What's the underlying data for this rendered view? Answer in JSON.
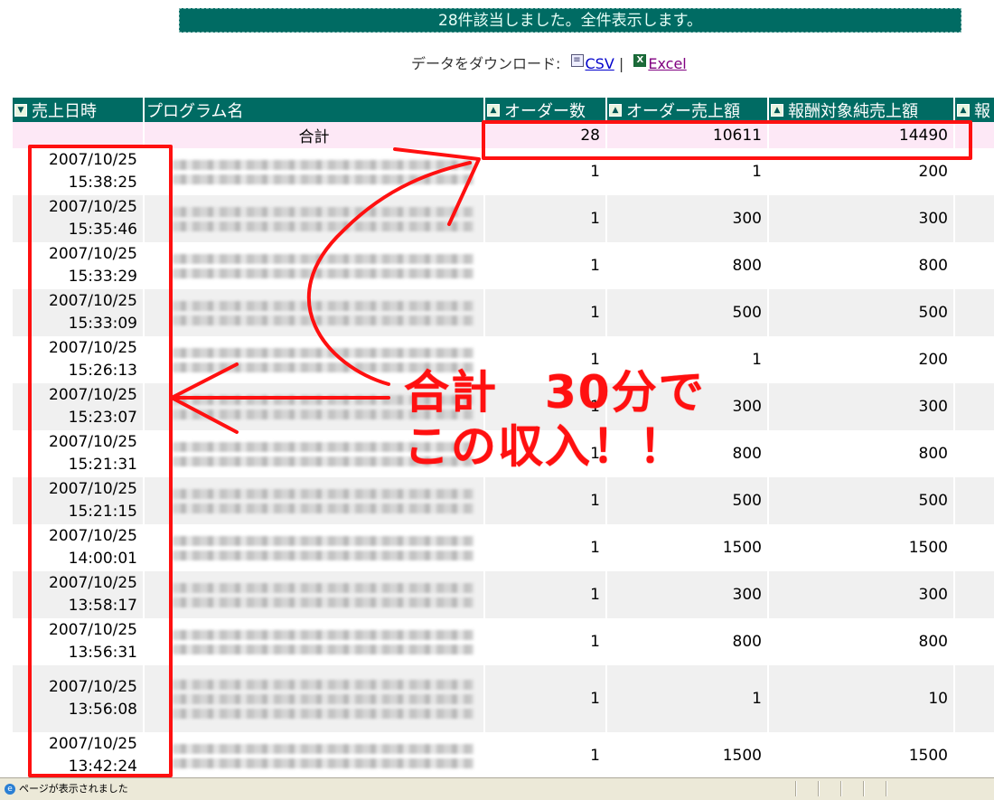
{
  "banner_text": "28件該当しました。全件表示します。",
  "download": {
    "label": "データをダウンロード:",
    "csv": "CSV",
    "separator": "|",
    "excel": "Excel"
  },
  "columns": [
    {
      "label": "売上日時",
      "sort_icon": true
    },
    {
      "label": "プログラム名",
      "sort_icon": false
    },
    {
      "label": "オーダー数",
      "sort_icon": true
    },
    {
      "label": "オーダー売上額",
      "sort_icon": true
    },
    {
      "label": "報酬対象純売上額",
      "sort_icon": true
    },
    {
      "label": "報",
      "sort_icon": true
    }
  ],
  "total": {
    "label": "合計",
    "orders": "28",
    "sales": "10611",
    "net": "14490"
  },
  "rows": [
    {
      "date": "2007/10/25",
      "time": "15:38:25",
      "orders": "1",
      "sales": "1",
      "net": "200"
    },
    {
      "date": "2007/10/25",
      "time": "15:35:46",
      "orders": "1",
      "sales": "300",
      "net": "300"
    },
    {
      "date": "2007/10/25",
      "time": "15:33:29",
      "orders": "1",
      "sales": "800",
      "net": "800"
    },
    {
      "date": "2007/10/25",
      "time": "15:33:09",
      "orders": "1",
      "sales": "500",
      "net": "500"
    },
    {
      "date": "2007/10/25",
      "time": "15:26:13",
      "orders": "1",
      "sales": "1",
      "net": "200"
    },
    {
      "date": "2007/10/25",
      "time": "15:23:07",
      "orders": "1",
      "sales": "300",
      "net": "300"
    },
    {
      "date": "2007/10/25",
      "time": "15:21:31",
      "orders": "1",
      "sales": "800",
      "net": "800"
    },
    {
      "date": "2007/10/25",
      "time": "15:21:15",
      "orders": "1",
      "sales": "500",
      "net": "500"
    },
    {
      "date": "2007/10/25",
      "time": "14:00:01",
      "orders": "1",
      "sales": "1500",
      "net": "1500"
    },
    {
      "date": "2007/10/25",
      "time": "13:58:17",
      "orders": "1",
      "sales": "300",
      "net": "300"
    },
    {
      "date": "2007/10/25",
      "time": "13:56:31",
      "orders": "1",
      "sales": "800",
      "net": "800"
    },
    {
      "date": "2007/10/25",
      "time": "13:56:08",
      "orders": "1",
      "sales": "1",
      "net": "10"
    },
    {
      "date": "2007/10/25",
      "time": "13:42:24",
      "orders": "1",
      "sales": "1500",
      "net": "1500"
    }
  ],
  "annotation": {
    "line1": "合計　30分で",
    "line2": "この収入！！",
    "color": "#ff1010"
  },
  "status_text": "ページが表示されました",
  "colors": {
    "header_bg": "#006b63",
    "total_bg": "#fde8f6",
    "stripe": "#f0f0f0"
  }
}
